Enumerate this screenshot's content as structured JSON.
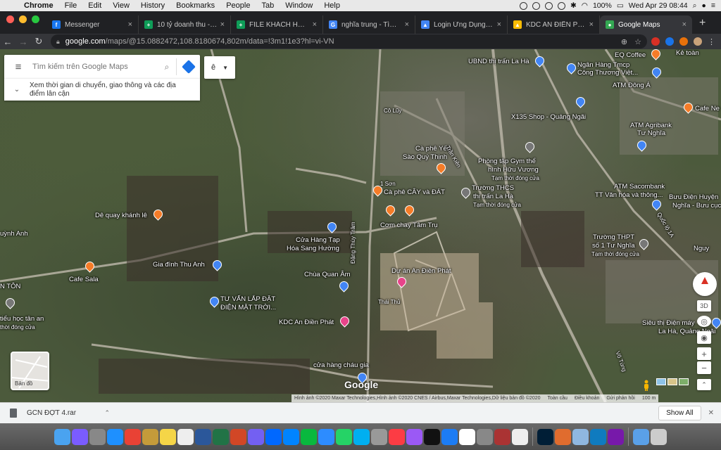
{
  "menubar": {
    "apple_icon": "apple-icon",
    "app_name": "Chrome",
    "menus": [
      "File",
      "Edit",
      "View",
      "History",
      "Bookmarks",
      "People",
      "Tab",
      "Window",
      "Help"
    ],
    "battery": "100%",
    "datetime": "Wed Apr 29  08:44"
  },
  "tabs": [
    {
      "title": "Messenger",
      "color": "#1877f2",
      "glyph": "f"
    },
    {
      "title": "10 tỷ doanh thu - Go",
      "color": "#0f9d58",
      "glyph": "+"
    },
    {
      "title": "FILE KHÁCH HÀNG Đ",
      "color": "#0f9d58",
      "glyph": "+"
    },
    {
      "title": "nghĩa trung - Tìm vớ",
      "color": "#4285f4",
      "glyph": "G"
    },
    {
      "title": "Login Ứng Dụng Bán",
      "color": "#4285f4",
      "glyph": "▲"
    },
    {
      "title": "KDC AN ĐIỀN PHÁT",
      "color": "#fbbc04",
      "glyph": "▲"
    },
    {
      "title": "Google Maps",
      "color": "#34a853",
      "glyph": "●"
    }
  ],
  "address": {
    "host": "google.com",
    "path": "/maps/@15.0882472,108.8180674,802m/data=!3m1!1e3?hl=vi-VN"
  },
  "search": {
    "placeholder": "Tìm kiếm trên Google Maps",
    "commute_text_1": "Xem thời gian di chuyển, giao thông và các địa",
    "commute_text_2": "điểm lân cận"
  },
  "image_button": {
    "label": "ê"
  },
  "map_labels": [
    {
      "text": "UBND thị trấn La Hà"
    },
    {
      "text": "EQ Coffee"
    },
    {
      "text": "Ngân Hàng Tmcp"
    },
    {
      "text": "Công Thương Việt..."
    },
    {
      "text": "ATM Đông Á"
    },
    {
      "text": "Cafe Ne"
    },
    {
      "text": "Cô Lũy"
    },
    {
      "text": "X135 Shop - Quảng Ngãi"
    },
    {
      "text": "ATM Agribank"
    },
    {
      "text": "Tư Nghĩa"
    },
    {
      "text": "Cà phê Yến"
    },
    {
      "text": "Sào Quý Thịnh"
    },
    {
      "text": "Phòng tập Gym thể"
    },
    {
      "text": "hình Hữu Vương"
    },
    {
      "text": "Tạm thời đóng cửa"
    },
    {
      "text": "Trường THCS"
    },
    {
      "text": "thị trấn La Hà"
    },
    {
      "text": "Tạm thời đóng cửa"
    },
    {
      "text": "ATM Sacombank"
    },
    {
      "text": "TT Văn hóa và thông..."
    },
    {
      "text": "Bưu Điện Huyện"
    },
    {
      "text": "Nghĩa - Bưu cục"
    },
    {
      "text": "Cà phê CÂY và ĐÁT"
    },
    {
      "text": "Cơm chay Tâm Trụ"
    },
    {
      "text": "Dê quay khánh lê"
    },
    {
      "text": "Cửa Hàng Tạp"
    },
    {
      "text": "Hóa Sang Hường"
    },
    {
      "text": "Trường THPT"
    },
    {
      "text": "số 1 Tư Nghĩa"
    },
    {
      "text": "Tạm thời đóng cửa"
    },
    {
      "text": "Gia đình Thu Anh"
    },
    {
      "text": "Cafe Sala"
    },
    {
      "text": "Chùa Quan Âm"
    },
    {
      "text": "Dự án An Điền Phát"
    },
    {
      "text": "Thái Thủ"
    },
    {
      "text": "TƯ VẤN LẮP ĐẶT"
    },
    {
      "text": "ĐIỆN MẶT TRỜI..."
    },
    {
      "text": "KDC An Điền Phát"
    },
    {
      "text": "Siêu thị Điện máy"
    },
    {
      "text": "La Hà, Quảng Ngãi"
    },
    {
      "text": "cửa hàng cháu gia"
    },
    {
      "text": "uỳnh Anh"
    },
    {
      "text": "N TÔN"
    },
    {
      "text": "tiểu học tân an"
    },
    {
      "text": "thời đóng cửa"
    },
    {
      "text": "Đặng Thùy Trâm"
    },
    {
      "text": "Trần Kiên"
    },
    {
      "text": "Võ Tùng"
    },
    {
      "text": "Quốc lộ 1A"
    },
    {
      "text": "Kẻ toàn"
    },
    {
      "text": "1 Sơn"
    },
    {
      "text": "Nguy"
    }
  ],
  "map_controls": {
    "minimap_label": "Bản đồ",
    "three_d": "3D",
    "zoom_in": "+",
    "zoom_out": "−",
    "google_logo": "Google"
  },
  "attribution": {
    "imagery": "Hình ảnh ©2020 Maxar Technologies,Hình ảnh ©2020 CNES / Airbus,Maxar Technologies,Dữ liệu bản đồ ©2020",
    "country": "Toàn cầu",
    "terms": "Điều khoản",
    "feedback": "Gửi phản hồi",
    "scale": "100 m"
  },
  "download_bar": {
    "filename": "GCN ĐỢT 4.rar",
    "show_all": "Show All"
  },
  "dock_apps": [
    {
      "name": "finder",
      "color": "#4aa3f0"
    },
    {
      "name": "siri",
      "color": "#7a5cff"
    },
    {
      "name": "launchpad",
      "color": "#888"
    },
    {
      "name": "safari",
      "color": "#1e90ff"
    },
    {
      "name": "chrome",
      "color": "#e94235"
    },
    {
      "name": "notes",
      "color": "#c49b3a"
    },
    {
      "name": "stickies",
      "color": "#f5d547"
    },
    {
      "name": "reminders",
      "color": "#eee"
    },
    {
      "name": "word",
      "color": "#2b579a"
    },
    {
      "name": "excel",
      "color": "#217346"
    },
    {
      "name": "powerpoint",
      "color": "#d24726"
    },
    {
      "name": "viber",
      "color": "#7360f2"
    },
    {
      "name": "zalo",
      "color": "#0068ff"
    },
    {
      "name": "messenger",
      "color": "#0084ff"
    },
    {
      "name": "wechat",
      "color": "#09b83e"
    },
    {
      "name": "zoom",
      "color": "#2d8cff"
    },
    {
      "name": "whatsapp",
      "color": "#25d366"
    },
    {
      "name": "skype",
      "color": "#00aff0"
    },
    {
      "name": "photos",
      "color": "#999"
    },
    {
      "name": "music",
      "color": "#fc3c44"
    },
    {
      "name": "podcasts",
      "color": "#9b59f5"
    },
    {
      "name": "tv",
      "color": "#111"
    },
    {
      "name": "app-store",
      "color": "#1c7cf4"
    },
    {
      "name": "calendar",
      "color": "#fff"
    },
    {
      "name": "system-preferences",
      "color": "#888"
    },
    {
      "name": "dictionary",
      "color": "#a33"
    },
    {
      "name": "font-book",
      "color": "#eee"
    },
    {
      "name": "photoshop",
      "color": "#001e36"
    },
    {
      "name": "paint",
      "color": "#e06c2e"
    },
    {
      "name": "preview",
      "color": "#8fb7e0"
    },
    {
      "name": "edge",
      "color": "#0f7bbf"
    },
    {
      "name": "onenote",
      "color": "#7719aa"
    },
    {
      "name": "folder",
      "color": "#5aa0e8"
    },
    {
      "name": "trash",
      "color": "#ccc"
    }
  ],
  "colors": {
    "pin_orange": "#f57c28",
    "pin_blue": "#4285f4",
    "pin_pink": "#e8448a",
    "pin_gray": "#777"
  }
}
